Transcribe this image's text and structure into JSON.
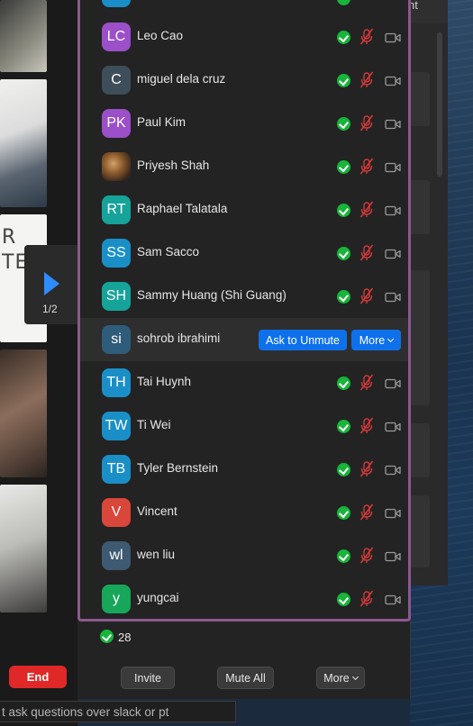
{
  "meeting": {
    "page_indicator": "1/2",
    "whiteboard_text": "R\nTES",
    "end_label": "End",
    "chat_input_value": "t ask questions over slack or pt"
  },
  "behind_panel": {
    "title_fragment": "nt"
  },
  "participants": [
    {
      "initials": "LC",
      "name": "Leo Cao",
      "color": "#9b4fc8"
    },
    {
      "initials": "C",
      "name": "miguel dela cruz",
      "color": "#3e4d5a"
    },
    {
      "initials": "PK",
      "name": "Paul Kim",
      "color": "#9b4fc8"
    },
    {
      "initials": "",
      "name": "Priyesh Shah",
      "color": "",
      "photo": true
    },
    {
      "initials": "RT",
      "name": "Raphael Talatala",
      "color": "#15a39a"
    },
    {
      "initials": "SS",
      "name": "Sam Sacco",
      "color": "#1a8fc7"
    },
    {
      "initials": "SH",
      "name": "Sammy Huang (Shi Guang)",
      "color": "#15a39a"
    },
    {
      "initials": "si",
      "name": "sohrob ibrahimi",
      "color": "#2f5c7a",
      "hover": true
    },
    {
      "initials": "TH",
      "name": "Tai Huynh",
      "color": "#1a8fc7"
    },
    {
      "initials": "TW",
      "name": "Ti Wei",
      "color": "#1a8fc7"
    },
    {
      "initials": "TB",
      "name": "Tyler Bernstein",
      "color": "#1a8fc7"
    },
    {
      "initials": "V",
      "name": "Vincent",
      "color": "#d9463a"
    },
    {
      "initials": "wl",
      "name": "wen liu",
      "color": "#3e5a72"
    },
    {
      "initials": "y",
      "name": "yungcai",
      "color": "#17a65a"
    }
  ],
  "hover_actions": {
    "ask_to_unmute": "Ask to Unmute",
    "more": "More"
  },
  "summary": {
    "count": "28"
  },
  "footer": {
    "invite": "Invite",
    "mute_all": "Mute All",
    "more": "More"
  },
  "colors": {
    "accent": "#0e71eb",
    "panel_border": "#8a5a8e",
    "status_ok": "#17b53a",
    "muted_mic": "#d23a3a",
    "end_button": "#e02828"
  }
}
